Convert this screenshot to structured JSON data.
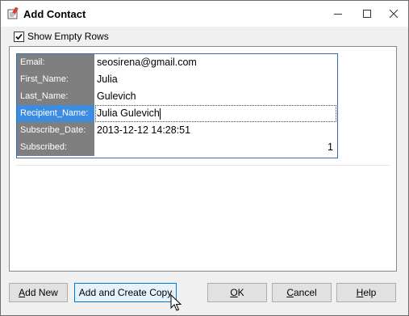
{
  "window": {
    "title": "Add Contact"
  },
  "options": {
    "show_empty_rows_label": "Show Empty Rows",
    "show_empty_rows_checked": true
  },
  "fields": [
    {
      "label": "Email:",
      "value": "seosirena@gmail.com"
    },
    {
      "label": "First_Name:",
      "value": "Julia"
    },
    {
      "label": "Last_Name:",
      "value": "Gulevich"
    },
    {
      "label": "Recipient_Name:",
      "value": "Julia Gulevich"
    },
    {
      "label": "Subscribe_Date:",
      "value": "2013-12-12 14:28:51"
    },
    {
      "label": "Subscribed:",
      "value": "1"
    }
  ],
  "buttons": {
    "add_new": {
      "underline": "A",
      "rest": "dd New"
    },
    "add_copy": {
      "label": "Add and Create Copy"
    },
    "ok": {
      "underline": "O",
      "rest": "K"
    },
    "cancel": {
      "underline": "C",
      "rest": "ancel"
    },
    "help": {
      "underline": "H",
      "rest": "elp"
    }
  }
}
